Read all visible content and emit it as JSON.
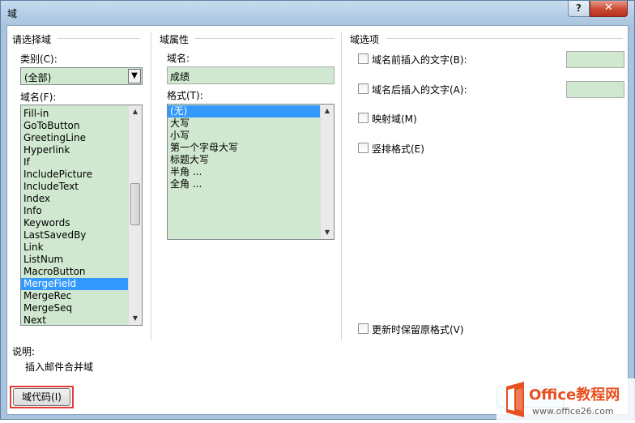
{
  "window": {
    "title": "域",
    "help_label": "?",
    "close_label": "✕"
  },
  "left_group": {
    "title": "请选择域",
    "category_label": "类别(C):",
    "category_value": "(全部)",
    "field_name_label": "域名(F):",
    "field_names": [
      "Fill-in",
      "GoToButton",
      "GreetingLine",
      "Hyperlink",
      "If",
      "IncludePicture",
      "IncludeText",
      "Index",
      "Info",
      "Keywords",
      "LastSavedBy",
      "Link",
      "ListNum",
      "MacroButton",
      "MergeField",
      "MergeRec",
      "MergeSeq",
      "Next"
    ],
    "selected_field": "MergeField"
  },
  "middle_group": {
    "title": "域属性",
    "name_label": "域名:",
    "name_value": "成绩",
    "format_label": "格式(T):",
    "formats": [
      "(无)",
      "大写",
      "小写",
      "第一个字母大写",
      "标题大写",
      "半角 ...",
      "全角 ..."
    ],
    "selected_format": "(无)"
  },
  "right_group": {
    "title": "域选项",
    "options": [
      {
        "label": "域名前插入的文字(B):",
        "checked": false,
        "has_field": true
      },
      {
        "label": "域名后插入的文字(A):",
        "checked": false,
        "has_field": true
      },
      {
        "label": "映射域(M)",
        "checked": false,
        "has_field": false
      },
      {
        "label": "竖排格式(E)",
        "checked": false,
        "has_field": false
      }
    ],
    "preserve_label": "更新时保留原格式(V)"
  },
  "description": {
    "label": "说明:",
    "text": "插入邮件合并域"
  },
  "footer": {
    "field_codes_button": "域代码(I)"
  },
  "logo": {
    "brand": "Office教程网",
    "url": "www.office26.com"
  },
  "colors": {
    "field_bg": "#cfe8cf",
    "selection": "#3399ff",
    "highlight": "#e43a3a",
    "logo_orange": "#e8501f"
  }
}
